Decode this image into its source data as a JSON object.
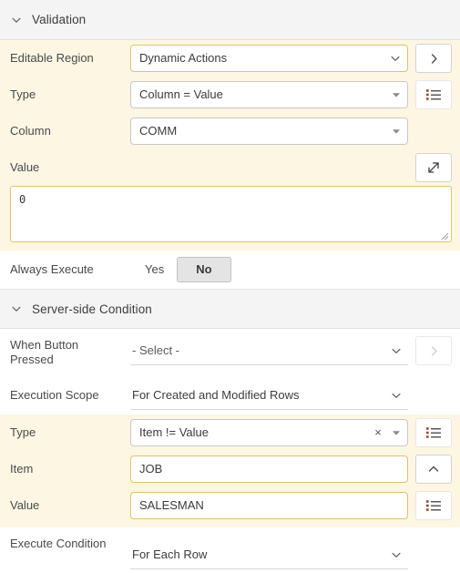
{
  "sections": [
    {
      "key": "validation",
      "title": "Validation",
      "chevron_icon": "chevron-down-icon",
      "expanded": true
    },
    {
      "key": "server_side_condition",
      "title": "Server-side Condition",
      "chevron_icon": "chevron-down-icon",
      "expanded": true
    }
  ],
  "validation": {
    "editable_region": {
      "label": "Editable Region",
      "value": "Dynamic Actions",
      "dropdown_icon": "chevron-down-icon",
      "side_button_icon": "chevron-right-icon",
      "side_button_enabled": true,
      "changed": true
    },
    "type": {
      "label": "Type",
      "value": "Column = Value",
      "dropdown_icon": "triangle-down-icon",
      "side_button_icon": "list-icon",
      "side_button_enabled": true,
      "changed": false
    },
    "column": {
      "label": "Column",
      "value": "COMM",
      "dropdown_icon": "triangle-down-icon",
      "changed": false
    },
    "value": {
      "label": "Value",
      "value": "0",
      "expand_button_icon": "expand-arrow-icon",
      "changed": true
    },
    "always_execute": {
      "label": "Always Execute",
      "options": [
        "Yes",
        "No"
      ],
      "selected": "No"
    }
  },
  "server_side_condition": {
    "when_button_pressed": {
      "label": "When Button Pressed",
      "value": "- Select -",
      "dropdown_icon": "chevron-down-icon",
      "side_button_icon": "chevron-right-icon",
      "side_button_enabled": false,
      "changed": false
    },
    "execution_scope": {
      "label": "Execution Scope",
      "value": "For Created and Modified Rows",
      "dropdown_icon": "chevron-down-icon",
      "changed": false
    },
    "type": {
      "label": "Type",
      "value": "Item != Value",
      "clear_icon": "clear-x-icon",
      "dropdown_icon": "triangle-down-icon",
      "side_button_icon": "list-icon",
      "side_button_enabled": true,
      "changed": true
    },
    "item": {
      "label": "Item",
      "value": "JOB",
      "side_button_icon": "chevron-up-icon",
      "side_button_enabled": true,
      "changed": true
    },
    "value": {
      "label": "Value",
      "value": "SALESMAN",
      "side_button_icon": "list-icon",
      "side_button_enabled": true,
      "changed": true
    },
    "execute_condition": {
      "label": "Execute Condition",
      "value": "For Each Row",
      "dropdown_icon": "chevron-down-icon",
      "changed": false
    }
  },
  "colors": {
    "changed_highlight_bg": "#fdf6e3",
    "changed_border": "#e0c36a",
    "section_header_bg": "#f4f4f4",
    "field_border": "#c8c8c8",
    "text": "#404040"
  }
}
